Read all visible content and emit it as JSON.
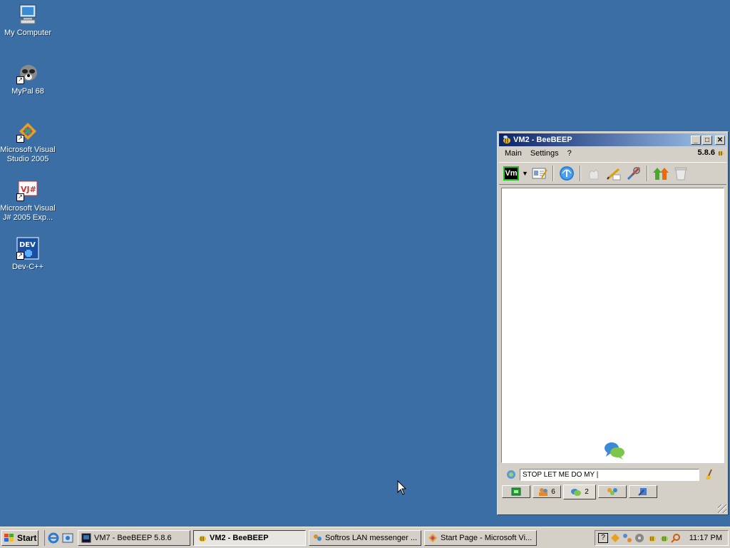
{
  "desktop": {
    "icons": [
      {
        "label": "My Computer",
        "icon": "computer-icon"
      },
      {
        "label": "MyPal 68",
        "icon": "raccoon-icon"
      },
      {
        "label": "Microsoft Visual Studio 2005",
        "icon": "visual-studio-icon"
      },
      {
        "label": "Microsoft Visual J# 2005 Exp...",
        "icon": "vjsharp-icon"
      },
      {
        "label": "Dev-C++",
        "icon": "devcpp-icon"
      }
    ],
    "background": "#3a6ea5"
  },
  "window": {
    "title": "VM2 - BeeBEEP",
    "menu": [
      "Main",
      "Settings",
      "?"
    ],
    "version": "5.8.6",
    "toolbar_vm_label": "Vm",
    "input_value": "STOP LET ME DO MY |",
    "tabs": [
      {
        "icon": "home-icon",
        "count": ""
      },
      {
        "icon": "users-icon",
        "count": "6"
      },
      {
        "icon": "chat-icon",
        "count": "2"
      },
      {
        "icon": "groups-icon",
        "count": ""
      },
      {
        "icon": "share-icon",
        "count": ""
      }
    ]
  },
  "taskbar": {
    "start_label": "Start",
    "tasks": [
      {
        "label": "VM7 - BeeBEEP 5.8.6"
      },
      {
        "label": "VM2 - BeeBEEP"
      },
      {
        "label": "Softros LAN messenger ..."
      },
      {
        "label": "Start Page - Microsoft Vi..."
      }
    ],
    "clock": "11:17 PM"
  },
  "colors": {
    "titlebar": "#0a246a",
    "desktop": "#3a6ea5",
    "chrome": "#d4d0c8"
  }
}
